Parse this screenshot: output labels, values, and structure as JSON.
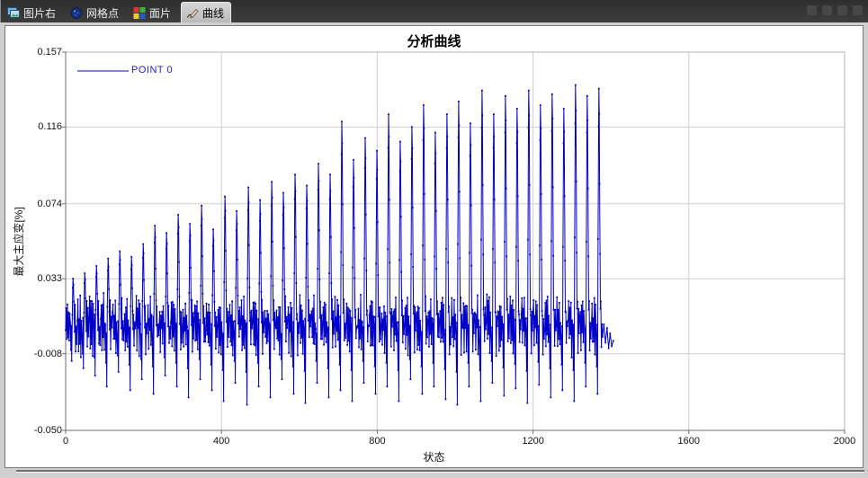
{
  "tabs": {
    "items": [
      {
        "label": "图片右",
        "icon": "photo-icon",
        "active": false
      },
      {
        "label": "网格点",
        "icon": "mesh-point-icon",
        "active": false
      },
      {
        "label": "面片",
        "icon": "patch-icon",
        "active": false
      },
      {
        "label": "曲线",
        "icon": "curve-pen-icon",
        "active": true
      }
    ]
  },
  "colors": {
    "series": "#0000C8",
    "legend_text": "#2323bd",
    "grid": "#cfcfcf",
    "axis_dark": "#6f6f6f",
    "axis_light": "#b5b5b5",
    "tabbar_bg": "#383838",
    "active_tab_bg": "#c6c6c6",
    "panel_bg": "#ffffff",
    "window_bg": "#cfcfcf"
  },
  "chart_data": {
    "type": "line",
    "title": "分析曲线",
    "xlabel": "状态",
    "ylabel": "最大主应变[%]",
    "xlim": [
      0,
      2000
    ],
    "ylim": [
      -0.05,
      0.157
    ],
    "xticks": [
      0,
      400,
      800,
      1200,
      1600,
      2000
    ],
    "yticks": [
      0.157,
      0.116,
      0.074,
      0.033,
      -0.008,
      -0.05
    ],
    "ytick_labels": [
      "0.157",
      "0.116",
      "0.074",
      "0.033",
      "-0.008",
      "-0.050"
    ],
    "grid": true,
    "legend": {
      "position": "top-left",
      "entries": [
        "POINT 0"
      ]
    },
    "series": [
      {
        "name": "POINT 0",
        "color": "#0000C8",
        "marker": "square",
        "cycle_width": 30,
        "baseline_band": [
          -0.006,
          0.021
        ],
        "shape": [
          [
            0,
            "b",
            0.01
          ],
          [
            1.5,
            "b",
            0.019
          ],
          [
            3,
            "b",
            -0.003
          ],
          [
            4.5,
            "b",
            0.016
          ],
          [
            6,
            "b",
            0.001
          ],
          [
            7.5,
            "b",
            0.02
          ],
          [
            9,
            "b",
            -0.005
          ],
          [
            10.5,
            "b",
            0.014
          ],
          [
            12,
            "b",
            0.004
          ],
          [
            13.5,
            "v",
            0.5
          ],
          [
            14.5,
            "b",
            0.008
          ],
          [
            15.5,
            "v",
            1
          ],
          [
            17,
            "p",
            0.4
          ],
          [
            18.3,
            "p",
            0.85
          ],
          [
            19,
            "p",
            1
          ],
          [
            20,
            "p",
            0.9
          ],
          [
            21,
            "p",
            0.62
          ],
          [
            22,
            "p",
            0.34
          ],
          [
            23,
            "p",
            0.12
          ],
          [
            24,
            "b",
            0.018
          ],
          [
            25.5,
            "b",
            -0.004
          ],
          [
            27,
            "b",
            0.012
          ],
          [
            28.5,
            "b",
            0.002
          ]
        ],
        "cycles": [
          [
            0.033,
            -0.012
          ],
          [
            0.036,
            -0.016
          ],
          [
            0.04,
            -0.02
          ],
          [
            0.044,
            -0.026
          ],
          [
            0.048,
            -0.018
          ],
          [
            0.045,
            -0.028
          ],
          [
            0.052,
            -0.022
          ],
          [
            0.062,
            -0.03
          ],
          [
            0.058,
            -0.02
          ],
          [
            0.068,
            -0.026
          ],
          [
            0.063,
            -0.032
          ],
          [
            0.073,
            -0.022
          ],
          [
            0.06,
            -0.028
          ],
          [
            0.078,
            -0.034
          ],
          [
            0.07,
            -0.024
          ],
          [
            0.083,
            -0.036
          ],
          [
            0.076,
            -0.026
          ],
          [
            0.086,
            -0.032
          ],
          [
            0.08,
            -0.022
          ],
          [
            0.09,
            -0.03
          ],
          [
            0.084,
            -0.035
          ],
          [
            0.096,
            -0.024
          ],
          [
            0.09,
            -0.032
          ],
          [
            0.119,
            -0.028
          ],
          [
            0.098,
            -0.034
          ],
          [
            0.11,
            -0.024
          ],
          [
            0.103,
            -0.03
          ],
          [
            0.123,
            -0.026
          ],
          [
            0.108,
            -0.034
          ],
          [
            0.116,
            -0.022
          ],
          [
            0.128,
            -0.03
          ],
          [
            0.113,
            -0.026
          ],
          [
            0.123,
            -0.033
          ],
          [
            0.13,
            -0.036
          ],
          [
            0.118,
            -0.026
          ],
          [
            0.136,
            -0.034
          ],
          [
            0.123,
            -0.024
          ],
          [
            0.133,
            -0.031
          ],
          [
            0.126,
            -0.027
          ],
          [
            0.136,
            -0.035
          ],
          [
            0.128,
            -0.025
          ],
          [
            0.134,
            -0.032
          ],
          [
            0.126,
            -0.028
          ],
          [
            0.139,
            -0.034
          ],
          [
            0.133,
            -0.026
          ],
          [
            0.137,
            -0.03
          ]
        ],
        "tail": [
          [
            1382,
            0.008
          ],
          [
            1386,
            -0.002
          ],
          [
            1390,
            0.006
          ],
          [
            1394,
            -0.005
          ],
          [
            1398,
            0.003
          ],
          [
            1402,
            -0.004
          ],
          [
            1406,
            -0.001
          ]
        ]
      }
    ]
  }
}
